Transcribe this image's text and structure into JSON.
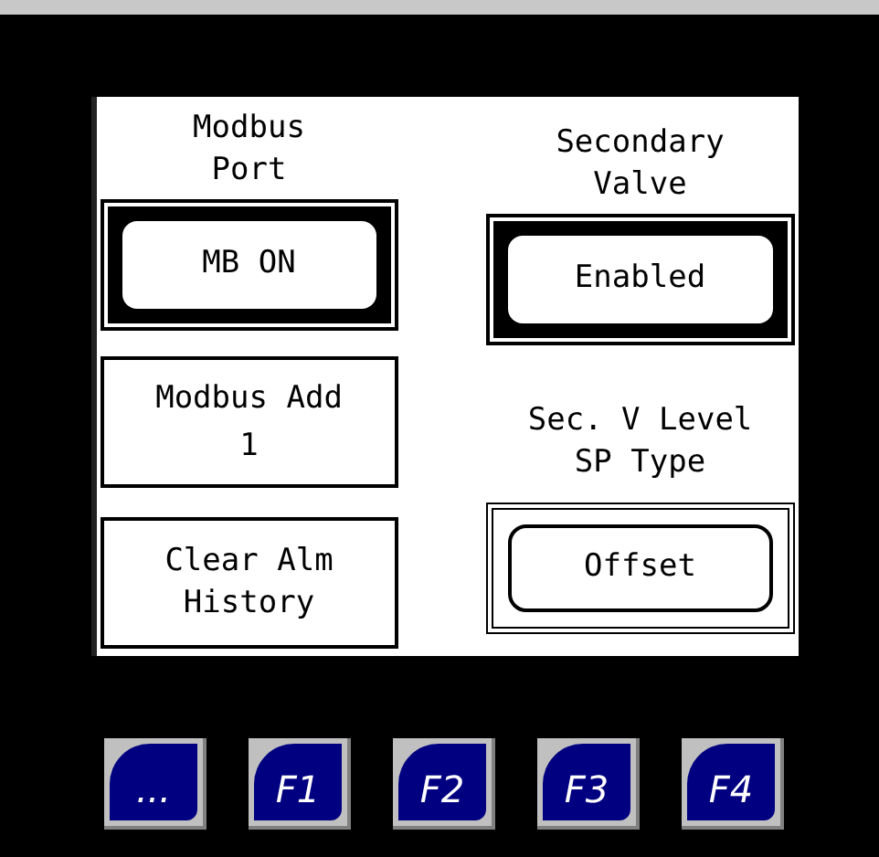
{
  "panel": {
    "left": [
      {
        "kind": "label",
        "text": "Modbus\nPort"
      },
      {
        "kind": "toggle",
        "text": "MB ON"
      },
      {
        "kind": "field",
        "label": "Modbus Add",
        "value": "1"
      },
      {
        "kind": "action",
        "text": "Clear Alm\nHistory"
      }
    ],
    "right": [
      {
        "kind": "label",
        "text": "Secondary\nValve"
      },
      {
        "kind": "toggle",
        "text": "Enabled"
      },
      {
        "kind": "label",
        "text": "Sec. V Level\nSP Type"
      },
      {
        "kind": "select",
        "text": "Offset"
      }
    ]
  },
  "function_keys": [
    "...",
    "F1",
    "F2",
    "F3",
    "F4"
  ]
}
